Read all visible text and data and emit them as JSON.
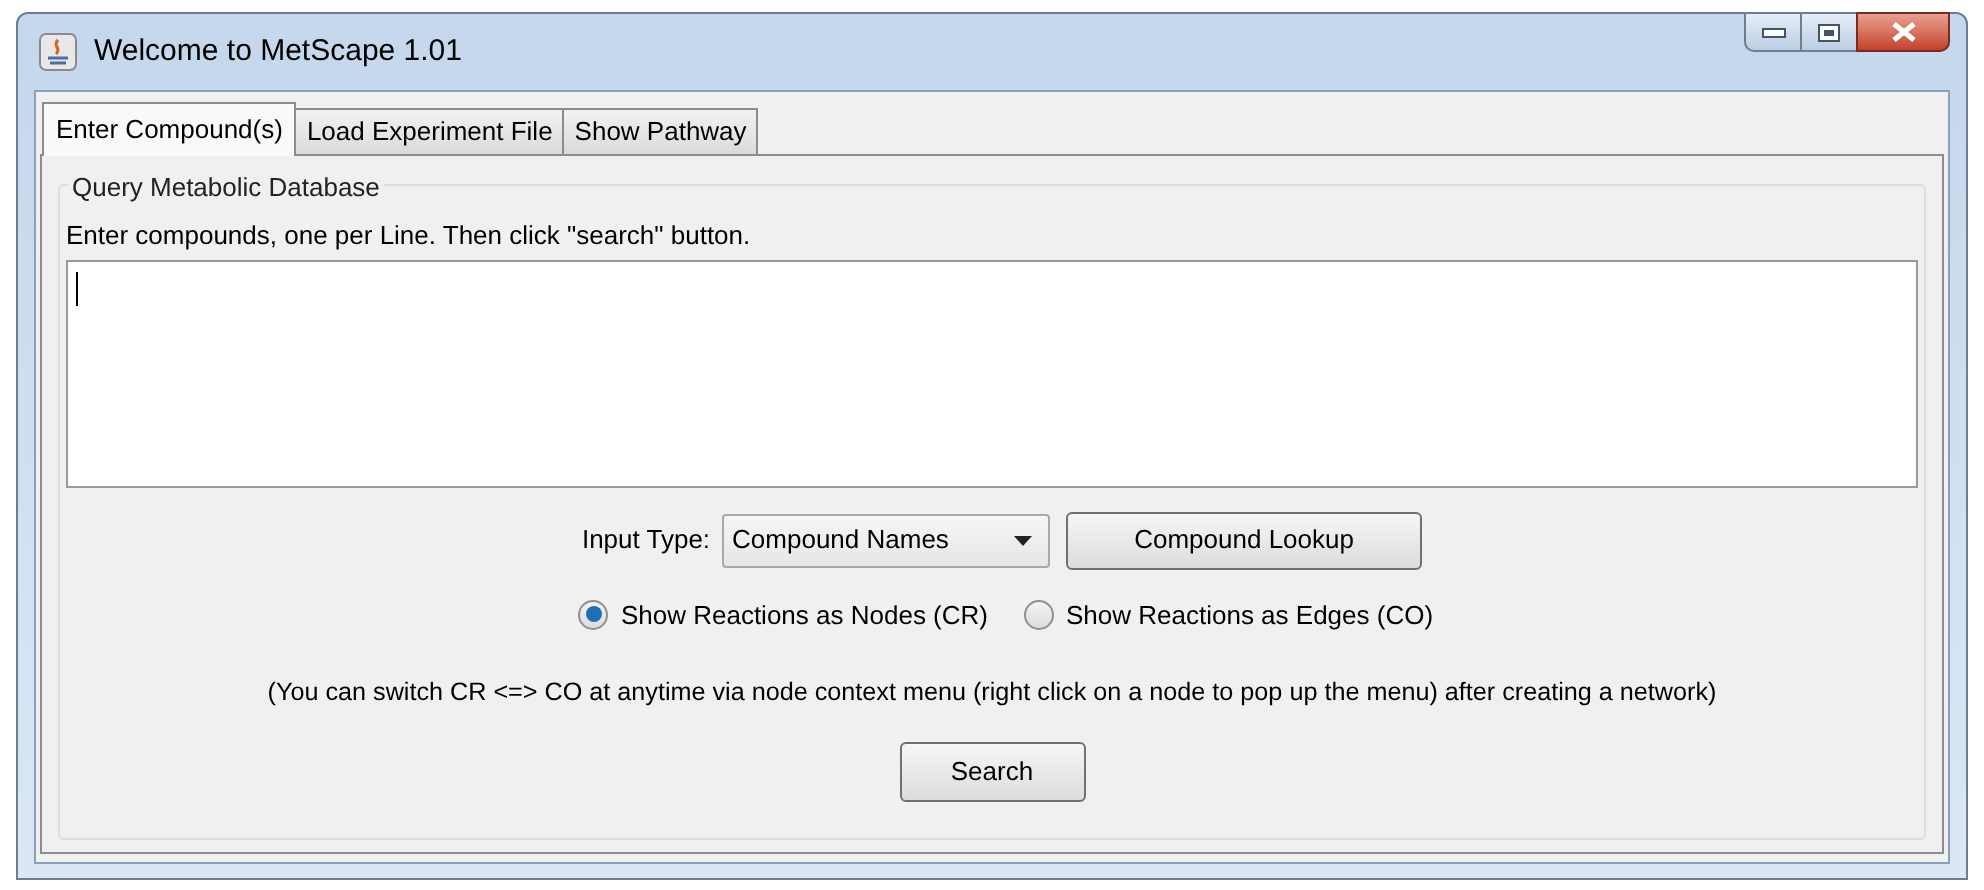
{
  "window": {
    "title": "Welcome to MetScape 1.01"
  },
  "tabs": [
    {
      "label": "Enter Compound(s)",
      "selected": true
    },
    {
      "label": "Load Experiment File",
      "selected": false
    },
    {
      "label": "Show Pathway",
      "selected": false
    }
  ],
  "group": {
    "title": "Query Metabolic Database",
    "instruction": "Enter compounds, one per Line. Then click \"search\" button."
  },
  "input_type": {
    "label": "Input Type:",
    "value": "Compound Names"
  },
  "lookup_button": "Compound Lookup",
  "radios": [
    {
      "label": "Show Reactions as Nodes (CR)",
      "selected": true
    },
    {
      "label": "Show Reactions as Edges (CO)",
      "selected": false
    }
  ],
  "note": "(You can switch CR <=> CO at anytime via node context menu (right click on a node to pop up the menu) after creating a network)",
  "search_button": "Search"
}
